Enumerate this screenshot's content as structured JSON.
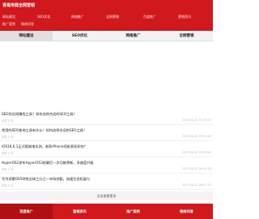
{
  "header": {
    "site_title": "青鸾传媒全网营销",
    "nav_row1": [
      "网站建设",
      "SEO优化",
      "网络推广",
      "全网营销",
      "百度推广",
      "营销资讯"
    ],
    "nav_row2": [
      "推广案例",
      "微商问答"
    ]
  },
  "tabs": {
    "items": [
      "网站建设",
      "SEO优化",
      "网络推广",
      "全网营销"
    ],
    "active_index": 0
  },
  "news": [
    {
      "title": "SEO优化网赚找工具？如何选择合适的SEO工具？",
      "meta": "浏览 0 次",
      "date": "2025-08-22 10:15:16"
    },
    {
      "title": "常用的SEO查询工具有什么？如何选择合适的SEO工具？",
      "meta": "浏览 0 次",
      "date": "2025-08-22 09:52:40"
    },
    {
      "title": "iOS18.6.1正式版耗电实测，老款iPhone续航表现如何？",
      "meta": "浏览 0 次",
      "date": "2025-08-22 09:30:05"
    },
    {
      "title": "HyperOS2发布HyperOS3前最后一次功能更新，多维度升级",
      "meta": "浏览 0 次",
      "date": "2025-08-22 09:12:33"
    },
    {
      "title": "华为鸿蒙OS5特效全球三分之一市场份额，加速生态拓展与",
      "meta": "浏览 0 次",
      "date": "2025-08-22 08:47:21"
    }
  ],
  "more_label": "点击查看更多",
  "footer": {
    "items": [
      "百度推广",
      "营销资讯",
      "推广案例",
      "微商问答"
    ],
    "active_index": 0
  },
  "colors": {
    "brand_red": "#d0181d",
    "footer_active": "#b01014",
    "tab_bg": "#f2f2f2",
    "tab_active": "#e0e0e0"
  }
}
